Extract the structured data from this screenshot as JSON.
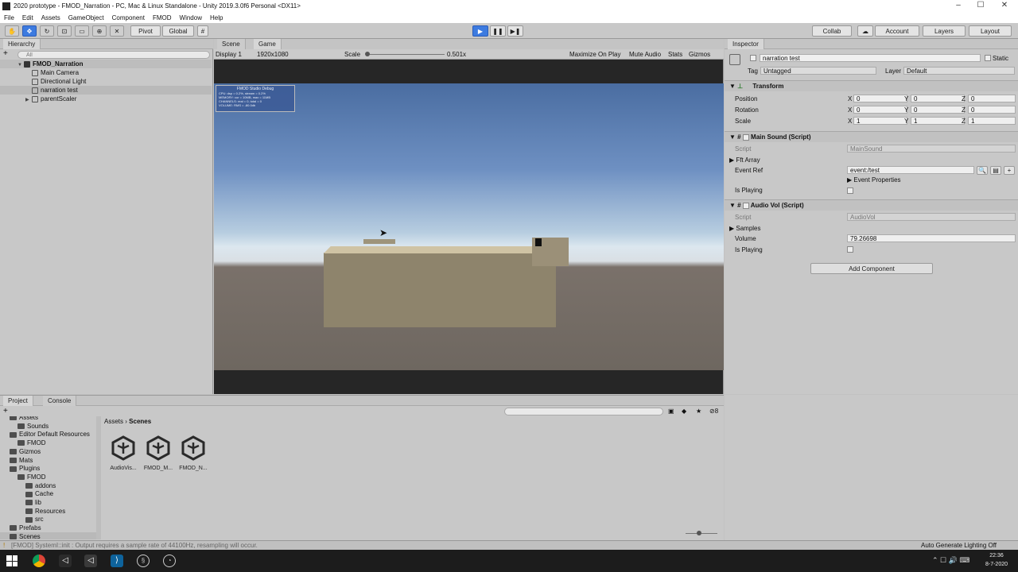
{
  "window": {
    "title": "2020 prototype - FMOD_Narration - PC, Mac & Linux Standalone - Unity 2019.3.0f6 Personal <DX11>",
    "controls": [
      "–",
      "☐",
      "✕"
    ]
  },
  "menu": [
    "File",
    "Edit",
    "Assets",
    "GameObject",
    "Component",
    "FMOD",
    "Window",
    "Help"
  ],
  "toolbar": {
    "pivot": "Pivot",
    "global": "Global",
    "collab": "Collab",
    "account": "Account",
    "layers": "Layers",
    "layout": "Layout"
  },
  "hierarchy": {
    "tab": "Hierarchy",
    "search_placeholder": "All",
    "scene": "FMOD_Narration",
    "items": [
      "Main Camera",
      "Directional Light",
      "narration test",
      "parentScaler"
    ]
  },
  "game": {
    "tab_scene": "Scene",
    "tab_game": "Game",
    "display": "Display 1",
    "resolution": "1920x1080",
    "scale_label": "Scale",
    "scale_value": "0.501x",
    "maximize": "Maximize On Play",
    "mute": "Mute Audio",
    "stats": "Stats",
    "gizmos": "Gizmos",
    "debug_title": "FMOD Studio Debug",
    "debug_lines": [
      "CPU: dsp = 0.2%, stream = 0.2%",
      "MEMORY: cur = 10MB, max = 11MB",
      "CHANNELS: real = 0, total = 0",
      "VOLUME: RMS = -80.0db"
    ]
  },
  "inspector": {
    "tab": "Inspector",
    "object_name": "narration test",
    "static": "Static",
    "tag_label": "Tag",
    "tag_value": "Untagged",
    "layer_label": "Layer",
    "layer_value": "Default",
    "transform": {
      "title": "Transform",
      "position_label": "Position",
      "rotation_label": "Rotation",
      "scale_label": "Scale",
      "position": [
        "0",
        "0",
        "0"
      ],
      "rotation": [
        "0",
        "0",
        "0"
      ],
      "scale": [
        "1",
        "1",
        "1"
      ]
    },
    "main_sound": {
      "title": "Main Sound (Script)",
      "script_label": "Script",
      "script_value": "MainSound",
      "fft": "Fft Array",
      "event_ref_label": "Event Ref",
      "event_ref_value": "event:/test",
      "event_props": "Event Properties",
      "is_playing": "Is Playing"
    },
    "audio_vol": {
      "title": "Audio Vol (Script)",
      "script_label": "Script",
      "script_value": "AudioVol",
      "samples": "Samples",
      "volume_label": "Volume",
      "volume_value": "79.26698",
      "is_playing": "Is Playing"
    },
    "add_component": "Add Component"
  },
  "project": {
    "tab_project": "Project",
    "tab_console": "Console",
    "breadcrumb": [
      "Assets",
      "Scenes"
    ],
    "badge_count": "8",
    "tree": [
      {
        "label": "Assets",
        "indent": 0
      },
      {
        "label": "Sounds",
        "indent": 1
      },
      {
        "label": "Editor Default Resources",
        "indent": 0
      },
      {
        "label": "FMOD",
        "indent": 1
      },
      {
        "label": "Gizmos",
        "indent": 0
      },
      {
        "label": "Mats",
        "indent": 0
      },
      {
        "label": "Plugins",
        "indent": 0
      },
      {
        "label": "FMOD",
        "indent": 1
      },
      {
        "label": "addons",
        "indent": 2
      },
      {
        "label": "Cache",
        "indent": 2
      },
      {
        "label": "lib",
        "indent": 2
      },
      {
        "label": "Resources",
        "indent": 2
      },
      {
        "label": "src",
        "indent": 2
      },
      {
        "label": "Prefabs",
        "indent": 0
      },
      {
        "label": "Scenes",
        "indent": 0
      }
    ],
    "assets": [
      "AudioVis...",
      "FMOD_M...",
      "FMOD_N..."
    ]
  },
  "status": {
    "message": "[FMOD] SystemI::init : Output requires a sample rate of 44100Hz, resampling will occur.",
    "lighting": "Auto Generate Lighting Off"
  },
  "taskbar": {
    "time": "22:36",
    "date": "8-7-2020"
  }
}
